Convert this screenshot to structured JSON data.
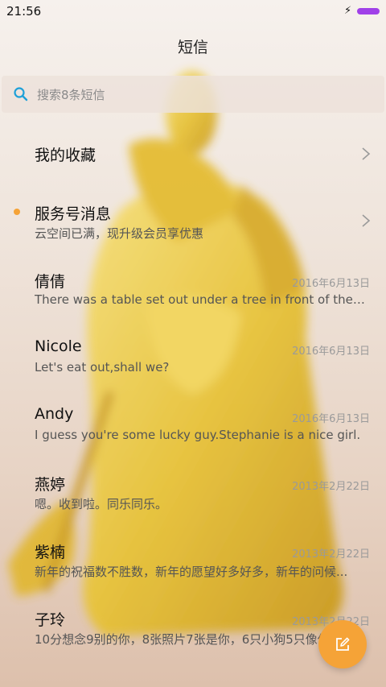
{
  "status_bar": {
    "time": "21:56",
    "charging_icon": "bolt-icon",
    "battery_color": "#a040e8"
  },
  "header": {
    "title": "短信"
  },
  "search": {
    "placeholder": "搜索8条短信",
    "icon": "search-icon"
  },
  "accent_color": "#f5a337",
  "list": {
    "favorites": {
      "name": "我的收藏"
    },
    "service": {
      "name": "服务号消息",
      "preview": "云空间已满，现升级会员享优惠",
      "unread_dot": true
    },
    "conversations": [
      {
        "name": "倩倩",
        "date": "2016年6月13日",
        "preview": "There was a table set out under a tree in front of the ho..."
      },
      {
        "name": "Nicole",
        "date": "2016年6月13日",
        "preview": "Let's eat out,shall we?"
      },
      {
        "name": "Andy",
        "date": "2016年6月13日",
        "preview": "I guess you're some lucky guy.Stephanie is a nice girl."
      },
      {
        "name": "燕婷",
        "date": "2013年2月22日",
        "preview": "嗯。收到啦。同乐同乐。"
      },
      {
        "name": "紫楠",
        "date": "2013年2月22日",
        "preview": "新年的祝福数不胜数，新年的愿望好多好多，新年的问候..."
      },
      {
        "name": "子玲",
        "date": "2013年2月22日",
        "preview": "10分想念9别的你，8张照片7张是你，6只小狗5只像你"
      }
    ]
  },
  "compose_button": {
    "icon": "compose-icon"
  }
}
